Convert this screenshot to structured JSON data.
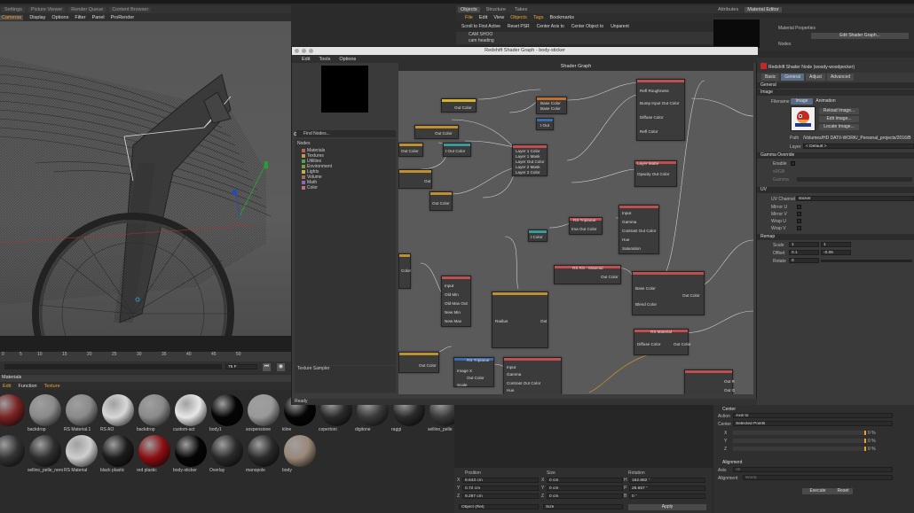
{
  "viewport": {
    "tabs": [
      "Settings",
      "Picture Viewer",
      "Render Queue",
      "Content Browser"
    ],
    "menu": [
      "Cameras",
      "Display",
      "Options",
      "Filter",
      "Panel",
      "ProRender"
    ],
    "timeline_ticks": [
      "0",
      "5",
      "10",
      "15",
      "20",
      "25",
      "30",
      "35",
      "40",
      "45",
      "50"
    ],
    "frame_value": "75 F"
  },
  "materials": {
    "title": "Materials",
    "menu": [
      "Edit",
      "Function",
      "Texture"
    ],
    "row1": [
      {
        "name": "",
        "color": "#7a2222"
      },
      {
        "name": "backdrop",
        "color": "#8a8a8a"
      },
      {
        "name": "RS Material.1",
        "color": "#8a8a8a"
      },
      {
        "name": "RS AO",
        "color": "#d8d8d8"
      },
      {
        "name": "backdrop",
        "color": "#8a8a8a"
      },
      {
        "name": "custom-act",
        "color": "#e8e8e8"
      },
      {
        "name": "body1",
        "color": "#050505"
      },
      {
        "name": "sospensione",
        "color": "#999999"
      },
      {
        "name": "kline",
        "color": "#050505"
      },
      {
        "name": "copertoni",
        "color": "#2a2a2a"
      },
      {
        "name": "digitone",
        "color": "#3a3a3a"
      },
      {
        "name": "raggi",
        "color": "#2a2a2a"
      },
      {
        "name": "sellino_pelle",
        "color": "#3a3a3a"
      }
    ],
    "row2": [
      {
        "name": "",
        "color": "#333333"
      },
      {
        "name": "sellino_pelle_nero",
        "color": "#2e2e2e"
      },
      {
        "name": "RS Material",
        "color": "#cfcfcf"
      },
      {
        "name": "black plastic",
        "color": "#1c1c1c"
      },
      {
        "name": "red plastic",
        "color": "#8c0f12"
      },
      {
        "name": "body-sticker",
        "color": "#050505"
      },
      {
        "name": "Overlay",
        "color": "#2a2a2a"
      },
      {
        "name": "manopole",
        "color": "#2a2a2a"
      },
      {
        "name": "body",
        "color": "#9a8878"
      }
    ]
  },
  "objects": {
    "tabs": [
      "Objects",
      "Structure",
      "Takes"
    ],
    "menu": [
      "File",
      "Edit",
      "View",
      "Objects",
      "Tags",
      "Bookmarks"
    ],
    "toolbar": [
      "Scroll to First Active",
      "Reset PSR",
      "Center Axis to",
      "Center Object to",
      "Unparent"
    ],
    "rows": [
      "CAM SHOO",
      "cam heading"
    ]
  },
  "attributes": {
    "tabs": [
      "Attributes",
      "Material Editor"
    ],
    "material_properties": "Material Properties",
    "edit_shader_graph": "Edit Shader Graph...",
    "nodes_label": "Nodes"
  },
  "shader_graph": {
    "window_title": "Redshift Shader Graph - body-sticker",
    "menu": [
      "Edit",
      "Tools",
      "Options"
    ],
    "find_nodes": "Find Nodes...",
    "nodes_header": "Nodes",
    "categories": [
      {
        "name": "Materials",
        "color": "#c25b5b"
      },
      {
        "name": "Textures",
        "color": "#b0a04a"
      },
      {
        "name": "Utilities",
        "color": "#5a9a5a"
      },
      {
        "name": "Environment",
        "color": "#7a9a4a"
      },
      {
        "name": "Lights",
        "color": "#c0b050"
      },
      {
        "name": "Volume",
        "color": "#a07050"
      },
      {
        "name": "Math",
        "color": "#8a6ab0"
      },
      {
        "name": "Color",
        "color": "#c07070"
      }
    ],
    "texture_sampler": "Texture Sampler",
    "status": "Ready",
    "graph_title": "Shader Graph"
  },
  "graph_nodes": {
    "n1": "Out Color",
    "n2a": "Base Color",
    "n2b": "Base Color",
    "n3": "Out Color",
    "n4": "t Out",
    "n5": "Refl Roughness",
    "n5b": "Bump Input Out Color",
    "n5c": "Diffuse Color",
    "n5d": "Refl Color",
    "n6": "Out Color",
    "n7": "t Out Color",
    "n8a": "Layer 1 Color",
    "n8b": "Layer 1 Mask",
    "n8c": "Layer Out Color",
    "n8d": "Layer 2 Mask",
    "n8e": "Layer 2 Color",
    "n9": "Out",
    "n10h": "Layer Matte",
    "n10": "Opacity Out Color",
    "n11": "Out Color",
    "n12h": "RS Triplanar",
    "n12": "Ima Out Color",
    "n13a": "Input",
    "n13b": "Gamma",
    "n13c": "Contrast Out Color",
    "n13d": "Hue",
    "n13e": "Saturation",
    "n14": "t Color",
    "n15": "Color",
    "n16h": "RS RS - Material",
    "n16": "Out Color",
    "n17a": "Input",
    "n17b": "Old Min",
    "n17c": "Old Max Out",
    "n17d": "New Min",
    "n17e": "New Max",
    "n18": "Radius",
    "n18b": "Out",
    "n19a": "Base Color",
    "n19b": "Out Color",
    "n19c": "Blend Color",
    "n20h": "RS Material",
    "n20a": "Diffuse Color",
    "n20b": "Out Color",
    "n21": "Out Color",
    "n22h": "RS Triplanar",
    "n22a": "Image X",
    "n22b": "Out Color",
    "n22c": "Scale",
    "n23a": "Input",
    "n23b": "Gamma",
    "n23c": "Contrast Out Color",
    "n23d": "Hue",
    "n23e": "Saturation",
    "n24a": "Out R",
    "n24b": "Out G",
    "n24c": "Input"
  },
  "shader_panel": {
    "title": "Redshift Shader Node (woody-woodpecker)",
    "tabs": [
      "Basic",
      "General",
      "Adjust",
      "Advanced"
    ],
    "active_tab": "General",
    "section_general": "General",
    "section_image": "Image",
    "filename_label": "Filename",
    "image_tab": "Image",
    "animation_tab": "Animation",
    "reload_image": "Reload Image...",
    "edit_image": "Edit Image...",
    "locate_image": "Locate Image...",
    "path_label": "Path",
    "path_value": "/Volumes/HD DATI/-WORK/_Personal_projects/2016/B",
    "layer_label": "Layer",
    "layer_value": "< Default >",
    "gamma_override": "Gamma Override",
    "enable": "Enable",
    "srgb": "sRGB",
    "gamma": "Gamma",
    "section_uv": "UV",
    "uv_channel_label": "UV Channel",
    "uv_channel_value": "sticker",
    "mirror_u": "Mirror U",
    "mirror_v": "Mirror V",
    "wrap_u": "Wrap U",
    "wrap_v": "Wrap V",
    "section_remap": "Remap",
    "scale_label": "Scale",
    "scale_u": "1",
    "scale_v": "1",
    "offset_label": "Offset",
    "offset_u": "0.1",
    "offset_v": "-0.06",
    "rotate_label": "Rotate",
    "rotate_value": "0"
  },
  "coords": {
    "headers": [
      "Position",
      "Size",
      "Rotation"
    ],
    "rows": [
      {
        "axis": "X",
        "pos": "8.643 cm",
        "size": "0 cm",
        "rot_axis": "H",
        "rot": "162.682 °"
      },
      {
        "axis": "Y",
        "pos": "0.72 cm",
        "size": "0 cm",
        "rot_axis": "P",
        "rot": "28.657 °"
      },
      {
        "axis": "Z",
        "pos": "9.297 cm",
        "size": "0 cm",
        "rot_axis": "B",
        "rot": "0 °"
      }
    ],
    "mode1": "Object (Rel)",
    "mode2": "Size",
    "apply": "Apply"
  },
  "axis_tool": {
    "center": "Center",
    "action_label": "Action",
    "action_value": "Axis to",
    "center_label": "Center",
    "center_value": "Selected Points",
    "x": "X",
    "y": "Y",
    "z": "Z",
    "pct": "0 %",
    "alignment": "Alignment",
    "axis_label": "Axis",
    "axis_value": "All",
    "alignment_label": "Alignment",
    "alignment_value": "World",
    "execute": "Execute",
    "reset": "Reset"
  }
}
